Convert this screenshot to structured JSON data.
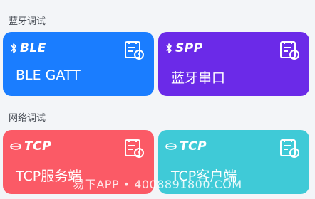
{
  "sections": [
    {
      "title": "蓝牙调试",
      "cards": [
        {
          "badge": "BLE",
          "label": "BLE GATT",
          "color": "#1a7dff",
          "badge_icon": "bluetooth-icon",
          "icon": "calendar-clock-icon"
        },
        {
          "badge": "SPP",
          "label": "蓝牙串口",
          "color": "#6b2ae8",
          "badge_icon": "bluetooth-icon",
          "icon": "calendar-clock-icon"
        }
      ]
    },
    {
      "title": "网络调试",
      "cards": [
        {
          "badge": "TCP",
          "label": "TCP服务端",
          "color": "#fb5a66",
          "badge_icon": "network-icon",
          "icon": "calendar-clock-icon"
        },
        {
          "badge": "TCP",
          "label": "TCP客户端",
          "color": "#3fcad7",
          "badge_icon": "network-icon",
          "icon": "calendar-clock-icon"
        }
      ]
    }
  ],
  "watermark": "易下APP • 4008891800.COM"
}
